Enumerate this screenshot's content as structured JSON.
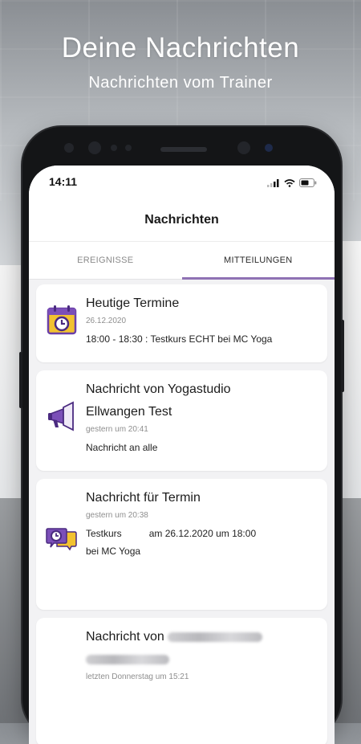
{
  "hero": {
    "title": "Deine Nachrichten",
    "subtitle": "Nachrichten vom Trainer"
  },
  "status_bar": {
    "time": "14:11"
  },
  "header": {
    "title": "Nachrichten"
  },
  "tabs": [
    {
      "label": "EREIGNISSE",
      "active": false
    },
    {
      "label": "MITTEILUNGEN",
      "active": true
    }
  ],
  "messages": [
    {
      "icon": "calendar-clock-icon",
      "title": "Heutige Termine",
      "date": "26.12.2020",
      "text": "18:00 - 18:30 : Testkurs ECHT bei MC Yoga"
    },
    {
      "icon": "megaphone-icon",
      "title_line1": "Nachricht von Yogastudio",
      "title_line2": "Ellwangen Test",
      "date": "gestern um 20:41",
      "text": "Nachricht an alle"
    },
    {
      "icon": "chat-clock-icon",
      "title": "Nachricht für Termin",
      "date": "gestern um 20:38",
      "text_part1": "Testkurs",
      "text_part2": "am 26.12.2020 um 18:00",
      "text_line2": "bei MC Yoga"
    },
    {
      "title": "Nachricht von",
      "date": "letzten Donnerstag um 15:21"
    }
  ],
  "colors": {
    "accent": "#8f72b4",
    "icon_purple": "#7b4fb8",
    "icon_yellow": "#f2c230"
  }
}
